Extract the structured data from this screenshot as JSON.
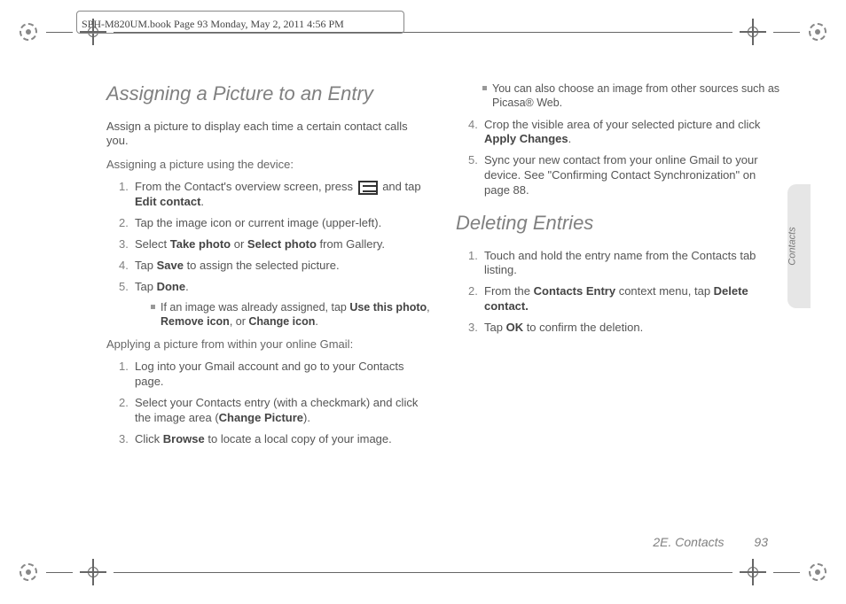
{
  "header": {
    "book_info": "SPH-M820UM.book  Page 93  Monday, May 2, 2011  4:56 PM"
  },
  "side_tab": {
    "label": "Contacts"
  },
  "footer": {
    "section": "2E. Contacts",
    "page": "93"
  },
  "col1": {
    "title": "Assigning a Picture to an Entry",
    "intro": "Assign a picture to display each time a certain contact calls you.",
    "sub1": "Assigning a picture using the device:",
    "steps1": {
      "n1": "1.",
      "t1a": "From the Contact's overview screen, press ",
      "t1b": " and tap ",
      "t1c": "Edit contact",
      "t1d": ".",
      "n2": "2.",
      "t2": "Tap the image icon or current image (upper-left).",
      "n3": "3.",
      "t3a": "Select ",
      "t3b": "Take photo",
      "t3c": " or ",
      "t3d": "Select photo",
      "t3e": " from Gallery.",
      "n4": "4.",
      "t4a": "Tap ",
      "t4b": "Save",
      "t4c": " to assign the selected picture.",
      "n5": "5.",
      "t5a": "Tap ",
      "t5b": "Done",
      "t5c": ".",
      "bulA": "If an image was already assigned, tap ",
      "bulB": "Use this photo",
      "bulC": ", ",
      "bulD": "Remove icon",
      "bulE": ", or ",
      "bulF": "Change icon",
      "bulG": "."
    },
    "sub2": "Applying a picture from within your online Gmail:",
    "steps2": {
      "n1": "1.",
      "t1": "Log into your Gmail account and go to your Contacts page.",
      "n2": "2.",
      "t2a": "Select your Contacts entry (with a checkmark) and click the image area (",
      "t2b": "Change Picture",
      "t2c": ").",
      "n3": "3.",
      "t3a": "Click ",
      "t3b": "Browse",
      "t3c": " to locate a local copy of your image."
    }
  },
  "col2": {
    "cont_bullet": "You can also choose an image from other sources such as Picasa® Web.",
    "steps2b": {
      "n4": "4.",
      "t4a": "Crop the visible area of your selected picture and click ",
      "t4b": "Apply Changes",
      "t4c": ".",
      "n5": "5.",
      "t5": "Sync your new contact from your online Gmail to your device. See \"Confirming Contact Synchronization\" on page 88."
    },
    "title2": "Deleting Entries",
    "del": {
      "n1": "1.",
      "t1": "Touch and hold the entry name from the Contacts tab listing.",
      "n2": "2.",
      "t2a": "From the ",
      "t2b": "Contacts Entry",
      "t2c": " context menu, tap ",
      "t2d": "Delete contact.",
      "n3": "3.",
      "t3a": "Tap ",
      "t3b": "OK",
      "t3c": " to confirm the deletion."
    }
  }
}
